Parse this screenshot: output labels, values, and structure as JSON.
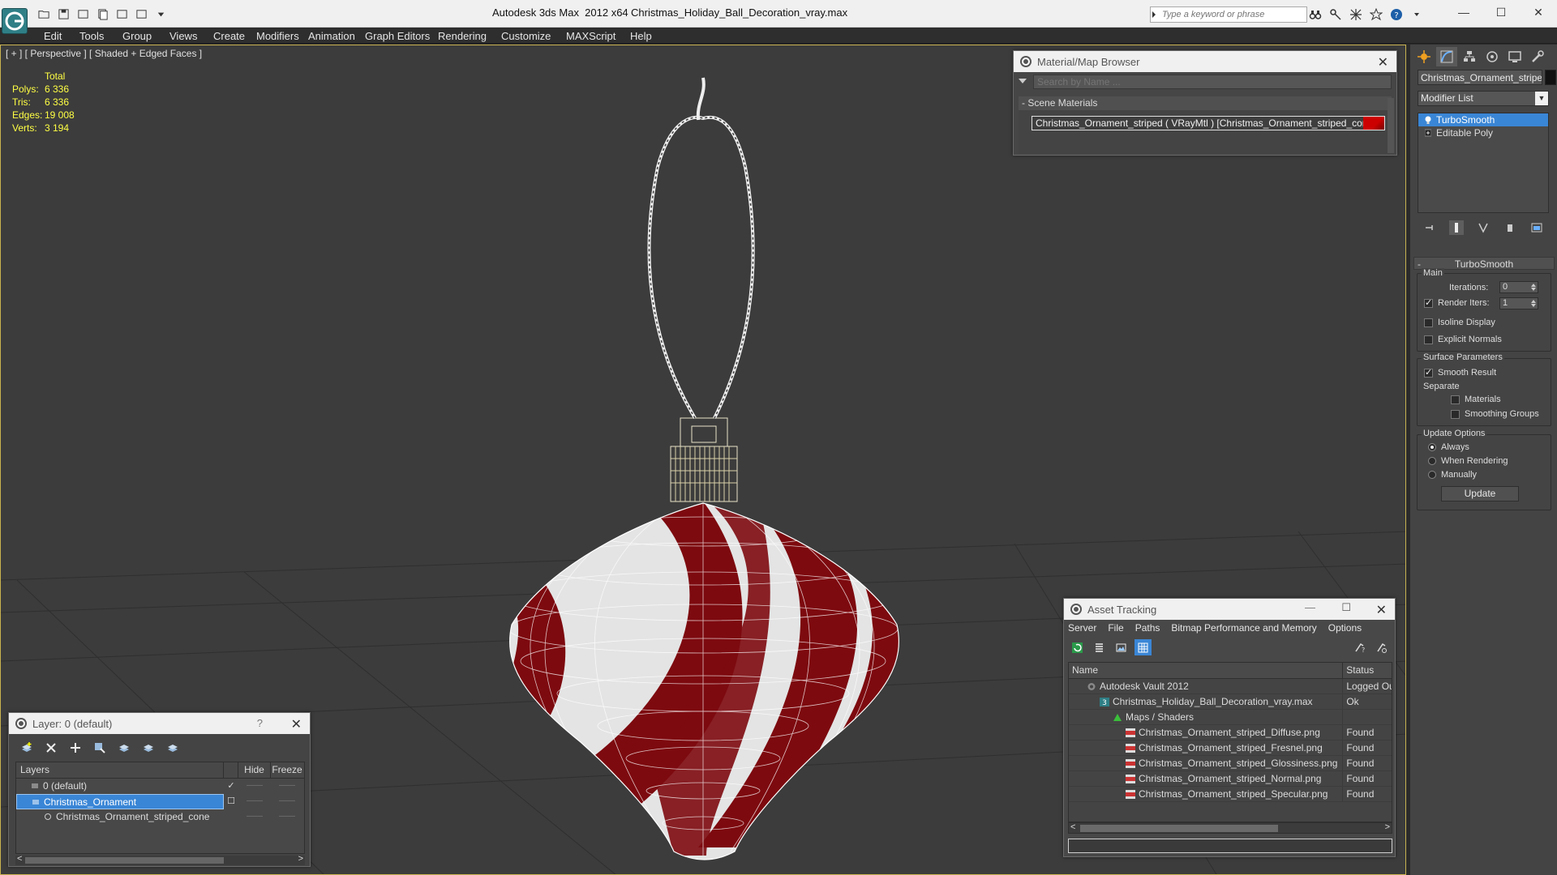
{
  "titlebar": {
    "app_title": "Autodesk 3ds Max  2012 x64",
    "file_title": "Christmas_Holiday_Ball_Decoration_vray.max",
    "search_placeholder": "Type a keyword or phrase",
    "minimize": "—",
    "maximize": "☐",
    "close": "✕"
  },
  "menu": [
    "Edit",
    "Tools",
    "Group",
    "Views",
    "Create",
    "Modifiers",
    "Animation",
    "Graph Editors",
    "Rendering",
    "Customize",
    "MAXScript",
    "Help"
  ],
  "viewport": {
    "label": "[ + ] [ Perspective ] [ Shaded + Edged Faces ]",
    "stats": {
      "header": "Total",
      "rows": [
        {
          "key": "Polys:",
          "value": "6 336"
        },
        {
          "key": "Tris:",
          "value": "6 336"
        },
        {
          "key": "Edges:",
          "value": "19 008"
        },
        {
          "key": "Verts:",
          "value": "3 194"
        }
      ]
    }
  },
  "material_browser": {
    "title": "Material/Map Browser",
    "search_placeholder": "Search by Name ...",
    "group": "Scene Materials",
    "group_prefix": "-",
    "item": "Christmas_Ornament_striped  ( VRayMtl ) [Christmas_Ornament_striped_cone]",
    "close": "✕"
  },
  "command_panel": {
    "object_name": "Christmas_Ornament_striped",
    "modifier_list": "Modifier List",
    "stack": [
      {
        "label": "TurboSmooth",
        "selected": true
      },
      {
        "label": "Editable Poly",
        "selected": false
      }
    ],
    "turbosmooth": {
      "title": "TurboSmooth",
      "collapse": "-",
      "main": "Main",
      "iterations_label": "Iterations:",
      "iterations": "0",
      "render_iters_label": "Render Iters:",
      "render_iters": "1",
      "isoline": "Isoline Display",
      "explicit_normals": "Explicit Normals",
      "surface_params": "Surface Parameters",
      "smooth_result": "Smooth Result",
      "separate": "Separate",
      "materials": "Materials",
      "smoothing_groups": "Smoothing Groups",
      "update_options": "Update Options",
      "always": "Always",
      "when_rendering": "When Rendering",
      "manually": "Manually",
      "update_button": "Update"
    }
  },
  "layer_window": {
    "title": "Layer: 0 (default)",
    "help": "?",
    "close": "✕",
    "columns": {
      "layers": "Layers",
      "hide": "Hide",
      "freeze": "Freeze"
    },
    "rows": [
      {
        "name": "0 (default)",
        "active_mark": "✓",
        "selected": false,
        "indent": 0
      },
      {
        "name": "Christmas_Ornament",
        "active_mark": "☐",
        "selected": true,
        "indent": 0
      },
      {
        "name": "Christmas_Ornament_striped_cone",
        "active_mark": "",
        "selected": false,
        "indent": 1
      }
    ],
    "dash": "——",
    "scroll_left": "<",
    "scroll_right": ">"
  },
  "asset_tracking": {
    "title": "Asset Tracking",
    "minimize": "—",
    "maximize": "☐",
    "close": "✕",
    "menu": [
      "Server",
      "File",
      "Paths",
      "Bitmap Performance and Memory",
      "Options"
    ],
    "columns": {
      "name": "Name",
      "status": "Status"
    },
    "rows": [
      {
        "name": "Autodesk Vault 2012",
        "status": "Logged Ou",
        "indent": 1,
        "icon": "vault"
      },
      {
        "name": "Christmas_Holiday_Ball_Decoration_vray.max",
        "status": "Ok",
        "indent": 2,
        "icon": "max"
      },
      {
        "name": "Maps / Shaders",
        "status": "",
        "indent": 3,
        "icon": "maps"
      },
      {
        "name": "Christmas_Ornament_striped_Diffuse.png",
        "status": "Found",
        "indent": 4,
        "icon": "png"
      },
      {
        "name": "Christmas_Ornament_striped_Fresnel.png",
        "status": "Found",
        "indent": 4,
        "icon": "png"
      },
      {
        "name": "Christmas_Ornament_striped_Glossiness.png",
        "status": "Found",
        "indent": 4,
        "icon": "png"
      },
      {
        "name": "Christmas_Ornament_striped_Normal.png",
        "status": "Found",
        "indent": 4,
        "icon": "png"
      },
      {
        "name": "Christmas_Ornament_striped_Specular.png",
        "status": "Found",
        "indent": 4,
        "icon": "png"
      }
    ],
    "scroll_left": "<",
    "scroll_right": ">"
  },
  "colors": {
    "stripe_red": "#7d0a0f",
    "stripe_white": "#e6e6e6",
    "selection": "#3a86d6",
    "stats_yellow": "#ffff44",
    "viewport_border": "#c8b250"
  }
}
